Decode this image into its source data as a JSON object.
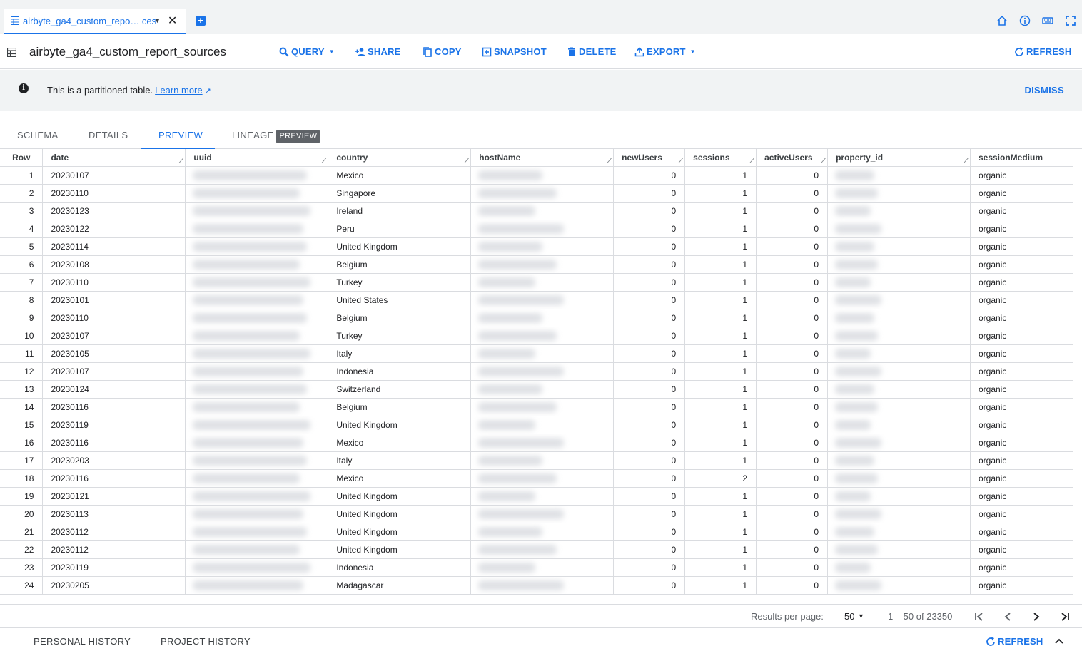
{
  "tab": {
    "title": "airbyte_ga4_custom_repo… ces"
  },
  "toolbar": {
    "title": "airbyte_ga4_custom_report_sources",
    "query": "QUERY",
    "share": "SHARE",
    "copy": "COPY",
    "snapshot": "SNAPSHOT",
    "delete": "DELETE",
    "export": "EXPORT",
    "refresh": "REFRESH"
  },
  "banner": {
    "message": "This is a partitioned table.",
    "learn_more": "Learn more",
    "dismiss": "DISMISS"
  },
  "view_tabs": [
    "SCHEMA",
    "DETAILS",
    "PREVIEW",
    "LINEAGE"
  ],
  "lineage_badge": "PREVIEW",
  "columns": [
    "Row",
    "date",
    "uuid",
    "country",
    "hostName",
    "newUsers",
    "sessions",
    "activeUsers",
    "property_id",
    "sessionMedium"
  ],
  "rows": [
    {
      "row": "1",
      "date": "20230107",
      "country": "Mexico",
      "newUsers": "0",
      "sessions": "1",
      "activeUsers": "0",
      "sessionMedium": "organic"
    },
    {
      "row": "2",
      "date": "20230110",
      "country": "Singapore",
      "newUsers": "0",
      "sessions": "1",
      "activeUsers": "0",
      "sessionMedium": "organic"
    },
    {
      "row": "3",
      "date": "20230123",
      "country": "Ireland",
      "newUsers": "0",
      "sessions": "1",
      "activeUsers": "0",
      "sessionMedium": "organic"
    },
    {
      "row": "4",
      "date": "20230122",
      "country": "Peru",
      "newUsers": "0",
      "sessions": "1",
      "activeUsers": "0",
      "sessionMedium": "organic"
    },
    {
      "row": "5",
      "date": "20230114",
      "country": "United Kingdom",
      "newUsers": "0",
      "sessions": "1",
      "activeUsers": "0",
      "sessionMedium": "organic"
    },
    {
      "row": "6",
      "date": "20230108",
      "country": "Belgium",
      "newUsers": "0",
      "sessions": "1",
      "activeUsers": "0",
      "sessionMedium": "organic"
    },
    {
      "row": "7",
      "date": "20230110",
      "country": "Turkey",
      "newUsers": "0",
      "sessions": "1",
      "activeUsers": "0",
      "sessionMedium": "organic"
    },
    {
      "row": "8",
      "date": "20230101",
      "country": "United States",
      "newUsers": "0",
      "sessions": "1",
      "activeUsers": "0",
      "sessionMedium": "organic"
    },
    {
      "row": "9",
      "date": "20230110",
      "country": "Belgium",
      "newUsers": "0",
      "sessions": "1",
      "activeUsers": "0",
      "sessionMedium": "organic"
    },
    {
      "row": "10",
      "date": "20230107",
      "country": "Turkey",
      "newUsers": "0",
      "sessions": "1",
      "activeUsers": "0",
      "sessionMedium": "organic"
    },
    {
      "row": "11",
      "date": "20230105",
      "country": "Italy",
      "newUsers": "0",
      "sessions": "1",
      "activeUsers": "0",
      "sessionMedium": "organic"
    },
    {
      "row": "12",
      "date": "20230107",
      "country": "Indonesia",
      "newUsers": "0",
      "sessions": "1",
      "activeUsers": "0",
      "sessionMedium": "organic"
    },
    {
      "row": "13",
      "date": "20230124",
      "country": "Switzerland",
      "newUsers": "0",
      "sessions": "1",
      "activeUsers": "0",
      "sessionMedium": "organic"
    },
    {
      "row": "14",
      "date": "20230116",
      "country": "Belgium",
      "newUsers": "0",
      "sessions": "1",
      "activeUsers": "0",
      "sessionMedium": "organic"
    },
    {
      "row": "15",
      "date": "20230119",
      "country": "United Kingdom",
      "newUsers": "0",
      "sessions": "1",
      "activeUsers": "0",
      "sessionMedium": "organic"
    },
    {
      "row": "16",
      "date": "20230116",
      "country": "Mexico",
      "newUsers": "0",
      "sessions": "1",
      "activeUsers": "0",
      "sessionMedium": "organic"
    },
    {
      "row": "17",
      "date": "20230203",
      "country": "Italy",
      "newUsers": "0",
      "sessions": "1",
      "activeUsers": "0",
      "sessionMedium": "organic"
    },
    {
      "row": "18",
      "date": "20230116",
      "country": "Mexico",
      "newUsers": "0",
      "sessions": "2",
      "activeUsers": "0",
      "sessionMedium": "organic"
    },
    {
      "row": "19",
      "date": "20230121",
      "country": "United Kingdom",
      "newUsers": "0",
      "sessions": "1",
      "activeUsers": "0",
      "sessionMedium": "organic"
    },
    {
      "row": "20",
      "date": "20230113",
      "country": "United Kingdom",
      "newUsers": "0",
      "sessions": "1",
      "activeUsers": "0",
      "sessionMedium": "organic"
    },
    {
      "row": "21",
      "date": "20230112",
      "country": "United Kingdom",
      "newUsers": "0",
      "sessions": "1",
      "activeUsers": "0",
      "sessionMedium": "organic"
    },
    {
      "row": "22",
      "date": "20230112",
      "country": "United Kingdom",
      "newUsers": "0",
      "sessions": "1",
      "activeUsers": "0",
      "sessionMedium": "organic"
    },
    {
      "row": "23",
      "date": "20230119",
      "country": "Indonesia",
      "newUsers": "0",
      "sessions": "1",
      "activeUsers": "0",
      "sessionMedium": "organic"
    },
    {
      "row": "24",
      "date": "20230205",
      "country": "Madagascar",
      "newUsers": "0",
      "sessions": "1",
      "activeUsers": "0",
      "sessionMedium": "organic"
    }
  ],
  "pagination": {
    "results_per_page_label": "Results per page:",
    "results_per_page": "50",
    "range": "1 – 50 of 23350"
  },
  "bottom": {
    "personal_history": "PERSONAL HISTORY",
    "project_history": "PROJECT HISTORY",
    "refresh": "REFRESH"
  },
  "colors": {
    "accent": "#1a73e8",
    "banner_bg": "#f1f3f4",
    "border": "#dadce0"
  }
}
